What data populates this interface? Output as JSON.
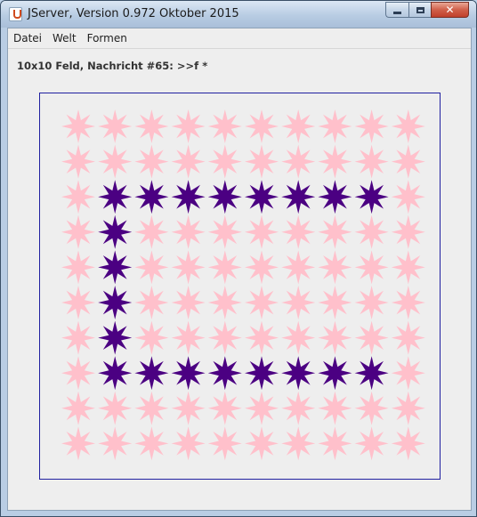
{
  "window": {
    "title": "JServer, Version 0.972 Oktober 2015",
    "icon": "java-icon",
    "controls": {
      "minimize": "minimize-icon",
      "maximize": "maximize-icon",
      "close": "close-icon",
      "close_glyph": "✕"
    }
  },
  "menubar": {
    "items": [
      {
        "label": "Datei"
      },
      {
        "label": "Welt"
      },
      {
        "label": "Formen"
      }
    ]
  },
  "status": {
    "message": "10x10 Feld, Nachricht #65: >>f *"
  },
  "board": {
    "rows": 10,
    "cols": 10,
    "shape": "star-8-point",
    "colors": {
      "default": "#ffc0cb",
      "highlight": "#4b0082",
      "border": "#2020a0"
    },
    "highlighted_cells": [
      [
        2,
        1
      ],
      [
        2,
        2
      ],
      [
        2,
        3
      ],
      [
        2,
        4
      ],
      [
        2,
        5
      ],
      [
        2,
        6
      ],
      [
        2,
        7
      ],
      [
        2,
        8
      ],
      [
        3,
        1
      ],
      [
        4,
        1
      ],
      [
        5,
        1
      ],
      [
        6,
        1
      ],
      [
        7,
        1
      ],
      [
        7,
        2
      ],
      [
        7,
        3
      ],
      [
        7,
        4
      ],
      [
        7,
        5
      ],
      [
        7,
        6
      ],
      [
        7,
        7
      ],
      [
        7,
        8
      ]
    ]
  }
}
